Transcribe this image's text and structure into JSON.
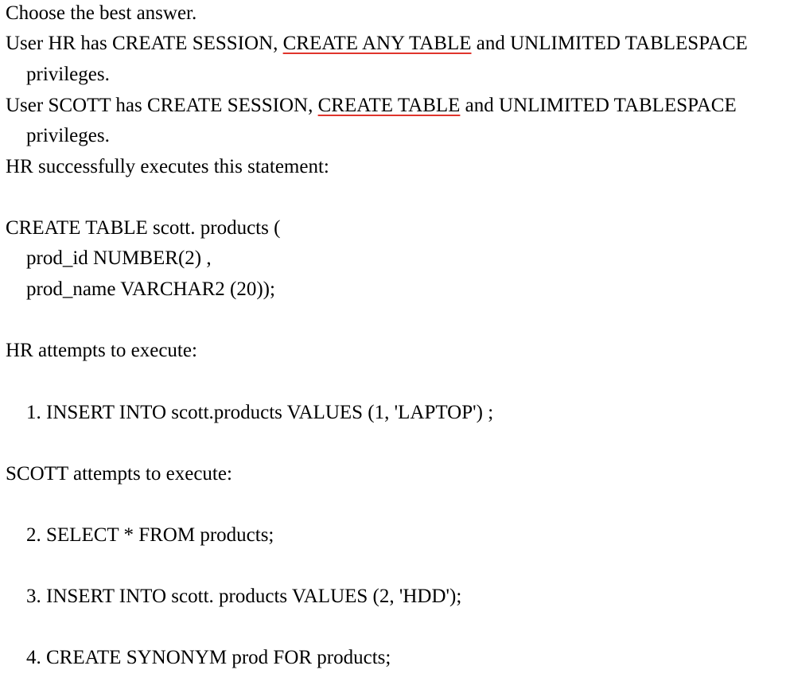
{
  "instruction": "Choose the best answer.",
  "hr_privileges": {
    "prefix": "User HR has CREATE SESSION,",
    "highlight": "CREATE ANY TABLE",
    "suffix": "and UNLIMITED TABLESPACE",
    "continuation": "privileges."
  },
  "scott_privileges": {
    "prefix": "User SCOTT has CREATE SESSION,",
    "highlight": "CREATE TABLE",
    "suffix": "and UNLIMITED TABLESPACE",
    "continuation": "privileges."
  },
  "hr_executes": "HR successfully executes this statement:",
  "create_statement": [
    "CREATE TABLE scott. products (",
    "prod_id NUMBER(2) ,",
    "prod_name VARCHAR2 (20));"
  ],
  "hr_attempts": "HR attempts to execute:",
  "hr_statements": [
    "1. INSERT INTO scott.products VALUES (1, 'LAPTOP') ;"
  ],
  "scott_attempts": "SCOTT attempts to execute:",
  "scott_statements": [
    "2. SELECT * FROM products;",
    "3. INSERT INTO scott. products VALUES (2, 'HDD');",
    "4. CREATE SYNONYM prod FOR products;"
  ],
  "colors": {
    "text": "#000000",
    "background": "#ffffff",
    "spellcheck_underline": "#e0342c"
  }
}
